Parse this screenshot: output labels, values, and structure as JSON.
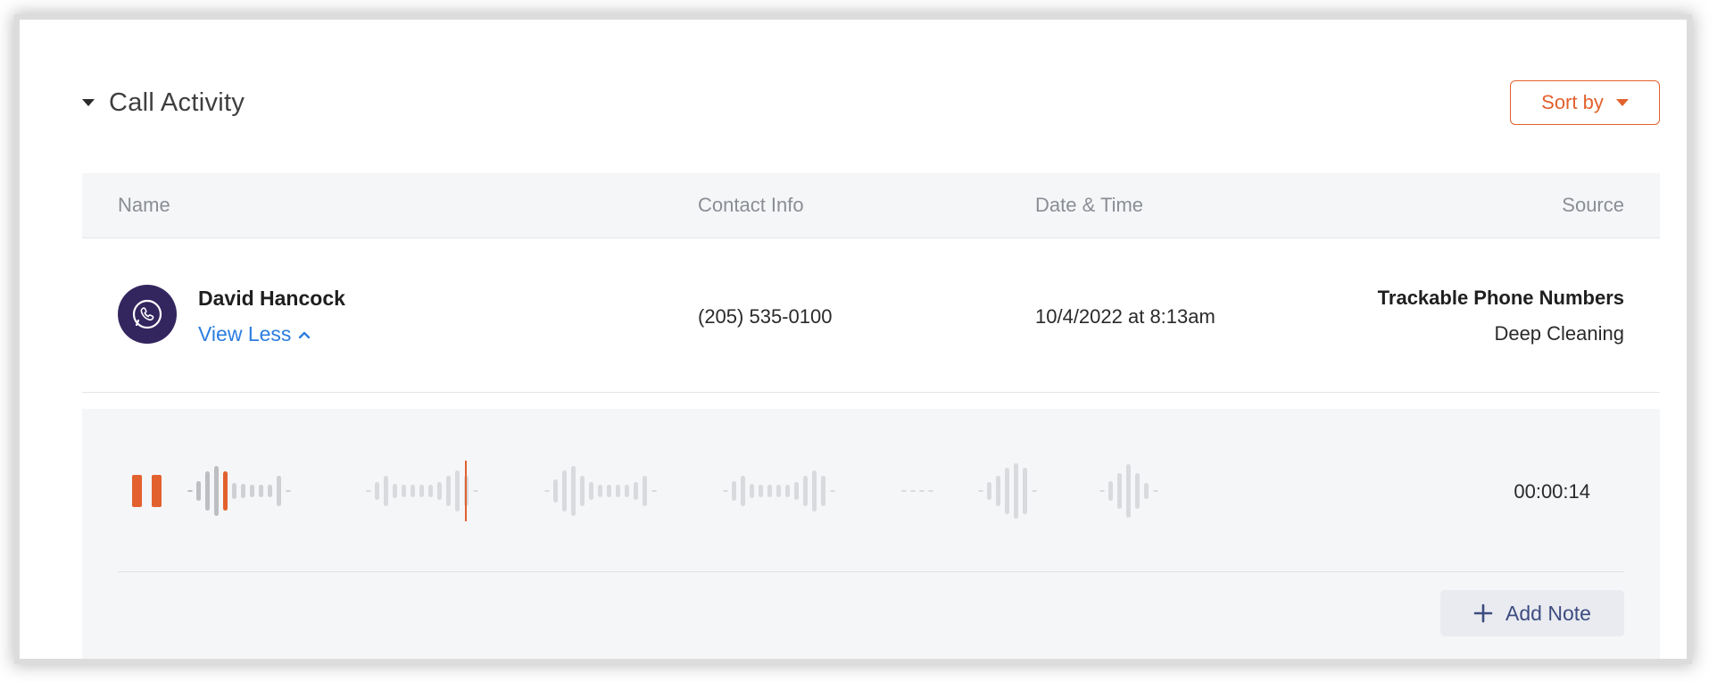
{
  "section": {
    "title": "Call Activity"
  },
  "sort": {
    "label": "Sort by"
  },
  "table": {
    "headers": [
      "Name",
      "Contact Info",
      "Date & Time",
      "Source"
    ]
  },
  "call": {
    "name": "David Hancock",
    "toggle_label": "View Less",
    "contact": "(205) 535-0100",
    "datetime": "10/4/2022 at 8:13am",
    "source_title": "Trackable Phone Numbers",
    "source_sub": "Deep Cleaning"
  },
  "player": {
    "state": "playing",
    "elapsed": "00:00:14",
    "add_note_label": "Add Note"
  },
  "colors": {
    "accent": "#e2612e",
    "link": "#2c7de0",
    "avatar_bg": "#33265f",
    "note_text": "#3d4c80"
  },
  "icons": [
    "caret-down-icon",
    "phone-icon",
    "chevron-up-icon",
    "pause-icon",
    "plus-icon"
  ]
}
